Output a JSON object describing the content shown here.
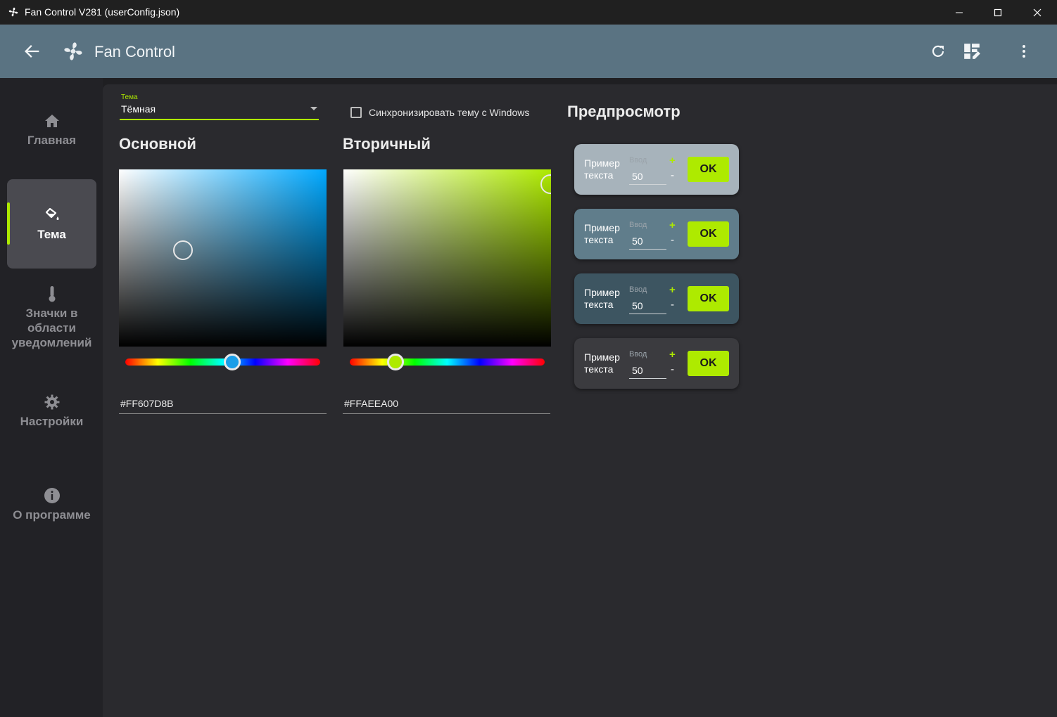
{
  "window": {
    "title": "Fan Control V281 (userConfig.json)",
    "controls": [
      "minimize-icon",
      "maximize-icon",
      "close-icon"
    ]
  },
  "header": {
    "title": "Fan Control",
    "icons": [
      "back-arrow-icon",
      "fan-logo-icon",
      "refresh-icon",
      "dashboard-edit-icon",
      "more-vert-icon"
    ]
  },
  "sidebar": {
    "items": [
      {
        "label": "Главная",
        "icon": "home-icon"
      },
      {
        "label": "Тема",
        "icon": "paint-bucket-icon",
        "active": true
      },
      {
        "label": "Значки в области уведомлений",
        "icon": "thermometer-icon"
      },
      {
        "label": "Настройки",
        "icon": "gear-icon"
      },
      {
        "label": "О программе",
        "icon": "info-icon"
      }
    ]
  },
  "theme": {
    "label": "Тема",
    "value": "Тёмная",
    "sync_label": "Синхронизировать тему с Windows",
    "sync_checked": false
  },
  "primary": {
    "title": "Основной",
    "hex": "#FF607D8B",
    "hue_color": "#00a8ff",
    "thumb_color": "#1a9ee8"
  },
  "secondary": {
    "title": "Вторичный",
    "hex": "#FFAEEA00",
    "hue_color": "#aeea00",
    "thumb_color": "#aeea00"
  },
  "preview": {
    "title": "Предпросмотр",
    "cards": [
      {
        "sample": "Пример текста",
        "input_label": "Ввод",
        "input_value": "50",
        "plus": "+",
        "minus": "-",
        "button": "OK",
        "bg": "#a7b3bb",
        "fg": "#ffffff"
      },
      {
        "sample": "Пример текста",
        "input_label": "Ввод",
        "input_value": "50",
        "plus": "+",
        "minus": "-",
        "button": "OK",
        "bg": "#607d8b",
        "fg": "#ffffff"
      },
      {
        "sample": "Пример текста",
        "input_label": "Ввод",
        "input_value": "50",
        "plus": "+",
        "minus": "-",
        "button": "OK",
        "bg": "#3d5561",
        "fg": "#ffffff"
      },
      {
        "sample": "Пример текста",
        "input_label": "Ввод",
        "input_value": "50",
        "plus": "+",
        "minus": "-",
        "button": "OK",
        "bg": "#3b3b3f",
        "fg": "#ffffff"
      }
    ]
  },
  "colors": {
    "accent": "#aeea00",
    "header_bg": "#5a7382",
    "content_bg": "#2a2a2e",
    "sidebar_bg": "#222226"
  }
}
